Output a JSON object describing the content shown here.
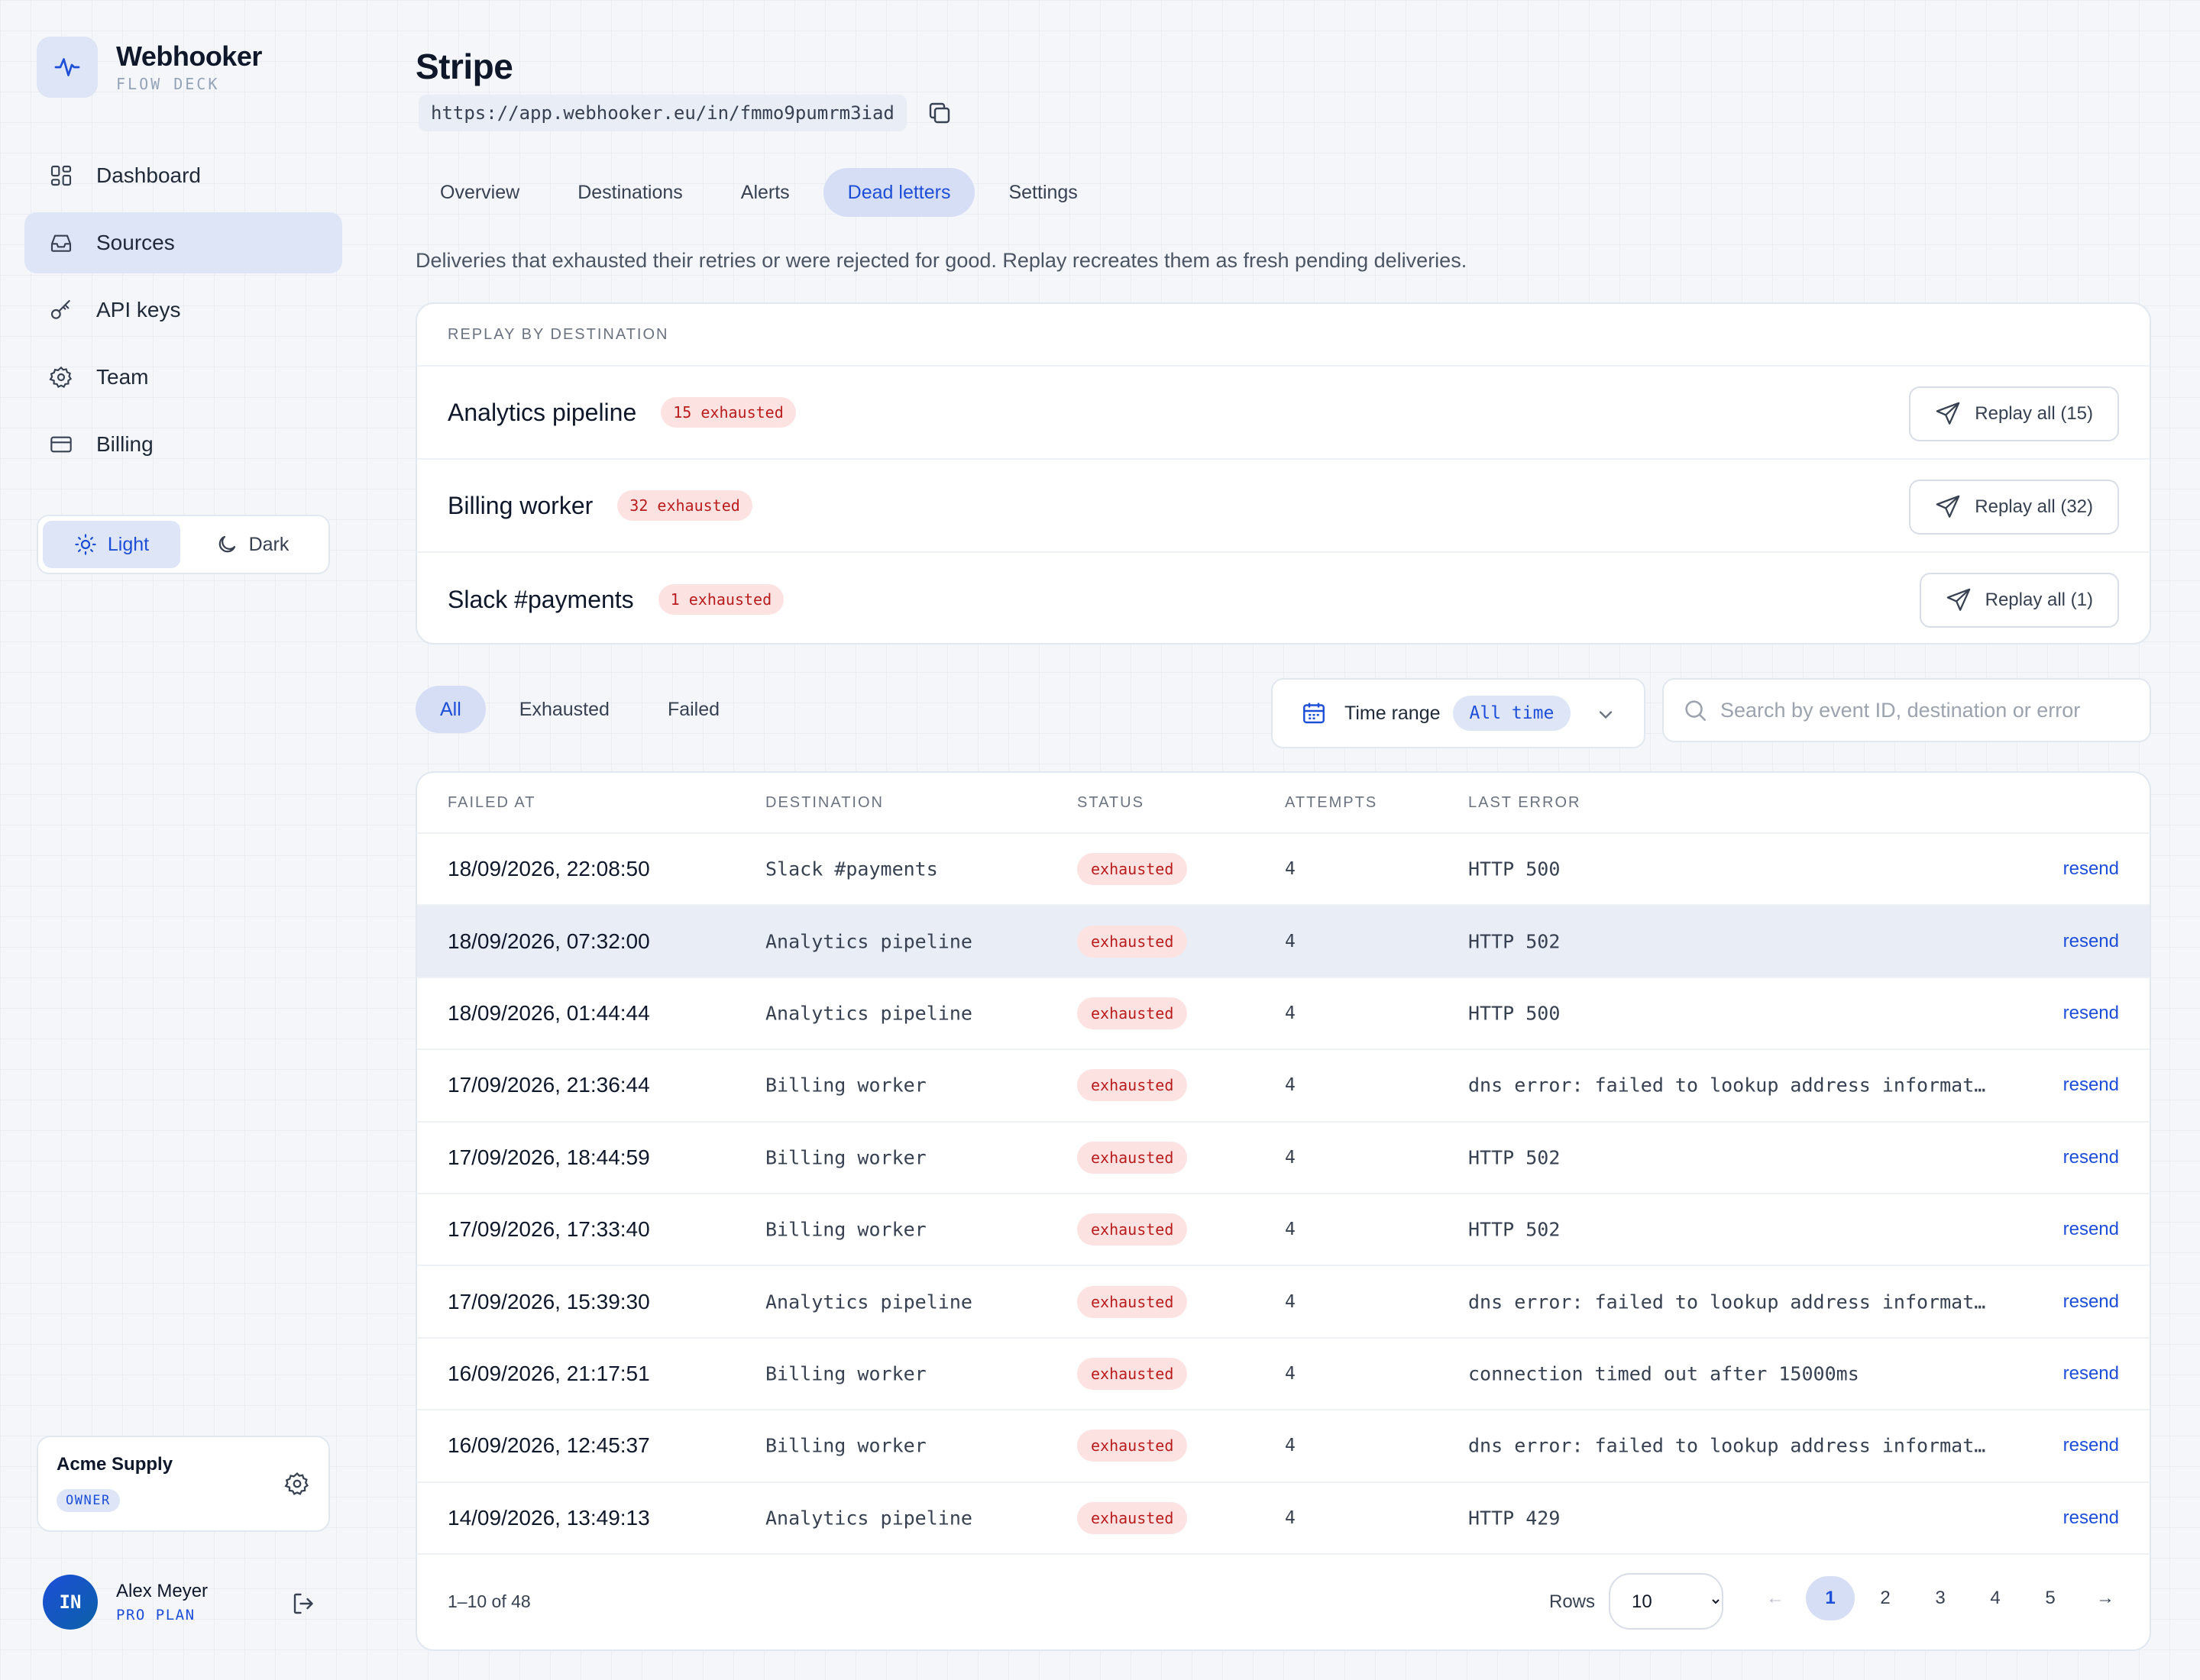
{
  "brand": {
    "name": "Webhooker",
    "subtitle": "FLOW DECK"
  },
  "sidebar": {
    "items": [
      {
        "label": "Dashboard",
        "icon": "dashboard-icon"
      },
      {
        "label": "Sources",
        "icon": "inbox-icon",
        "active": true
      },
      {
        "label": "API keys",
        "icon": "key-icon"
      },
      {
        "label": "Team",
        "icon": "gear-icon"
      },
      {
        "label": "Billing",
        "icon": "credit-card-icon"
      }
    ],
    "theme": {
      "light": "Light",
      "dark": "Dark",
      "selected": "Light"
    },
    "org": {
      "name": "Acme Supply",
      "role": "OWNER"
    },
    "user": {
      "initials": "IN",
      "name": "Alex Meyer",
      "plan": "PRO PLAN"
    }
  },
  "header": {
    "title": "Stripe",
    "url": "https://app.webhooker.eu/in/fmmo9pumrm3iad"
  },
  "tabs": [
    "Overview",
    "Destinations",
    "Alerts",
    "Dead letters",
    "Settings"
  ],
  "active_tab": "Dead letters",
  "description": "Deliveries that exhausted their retries or were rejected for good. Replay recreates them as fresh pending deliveries.",
  "replay": {
    "heading": "REPLAY BY DESTINATION",
    "rows": [
      {
        "name": "Analytics pipeline",
        "badge": "15 exhausted",
        "button": "Replay all (15)"
      },
      {
        "name": "Billing worker",
        "badge": "32 exhausted",
        "button": "Replay all (32)"
      },
      {
        "name": "Slack #payments",
        "badge": "1 exhausted",
        "button": "Replay all (1)"
      }
    ]
  },
  "filters": [
    "All",
    "Exhausted",
    "Failed"
  ],
  "active_filter": "All",
  "time_range": {
    "label": "Time range",
    "value": "All time"
  },
  "search": {
    "placeholder": "Search by event ID, destination or error",
    "value": ""
  },
  "table": {
    "columns": [
      "FAILED AT",
      "DESTINATION",
      "STATUS",
      "ATTEMPTS",
      "LAST ERROR"
    ],
    "rows": [
      {
        "time": "18/09/2026, 22:08:50",
        "dest": "Slack #payments",
        "status": "exhausted",
        "attempts": "4",
        "error": "HTTP 500",
        "action": "resend"
      },
      {
        "time": "18/09/2026, 07:32:00",
        "dest": "Analytics pipeline",
        "status": "exhausted",
        "attempts": "4",
        "error": "HTTP 502",
        "action": "resend",
        "highlight": true
      },
      {
        "time": "18/09/2026, 01:44:44",
        "dest": "Analytics pipeline",
        "status": "exhausted",
        "attempts": "4",
        "error": "HTTP 500",
        "action": "resend"
      },
      {
        "time": "17/09/2026, 21:36:44",
        "dest": "Billing worker",
        "status": "exhausted",
        "attempts": "4",
        "error": "dns error: failed to lookup address informat…",
        "action": "resend"
      },
      {
        "time": "17/09/2026, 18:44:59",
        "dest": "Billing worker",
        "status": "exhausted",
        "attempts": "4",
        "error": "HTTP 502",
        "action": "resend"
      },
      {
        "time": "17/09/2026, 17:33:40",
        "dest": "Billing worker",
        "status": "exhausted",
        "attempts": "4",
        "error": "HTTP 502",
        "action": "resend"
      },
      {
        "time": "17/09/2026, 15:39:30",
        "dest": "Analytics pipeline",
        "status": "exhausted",
        "attempts": "4",
        "error": "dns error: failed to lookup address informat…",
        "action": "resend"
      },
      {
        "time": "16/09/2026, 21:17:51",
        "dest": "Billing worker",
        "status": "exhausted",
        "attempts": "4",
        "error": "connection timed out after 15000ms",
        "action": "resend"
      },
      {
        "time": "16/09/2026, 12:45:37",
        "dest": "Billing worker",
        "status": "exhausted",
        "attempts": "4",
        "error": "dns error: failed to lookup address informat…",
        "action": "resend"
      },
      {
        "time": "14/09/2026, 13:49:13",
        "dest": "Analytics pipeline",
        "status": "exhausted",
        "attempts": "4",
        "error": "HTTP 429",
        "action": "resend"
      }
    ]
  },
  "footer": {
    "range": "1–10 of 48",
    "rows_label": "Rows",
    "rows_value": "10",
    "pages": [
      "1",
      "2",
      "3",
      "4",
      "5"
    ],
    "active_page": "1",
    "prev": "←",
    "next": "→"
  },
  "colors": {
    "accent": "#1d4ed8",
    "accent_soft": "#dde5f7",
    "danger": "#b91c1c",
    "danger_soft": "#fde2e2"
  }
}
